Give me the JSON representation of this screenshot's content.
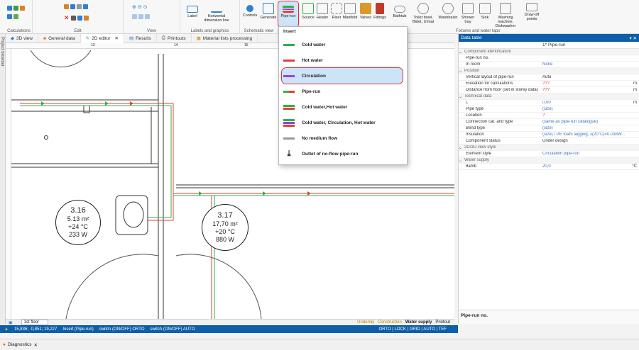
{
  "ribbon": {
    "groups": [
      "Calculations",
      "Edit",
      "View",
      "Labels and graphics",
      "Schematic view",
      "Fixtures and water taps"
    ],
    "buttons": {
      "label": "Label",
      "horizontal_dimension_line": "Horizontal dimension line",
      "controls": "Controls",
      "generate": "Generate",
      "pipe_run": "Pipe-run",
      "source": "Source",
      "heater": "Heater",
      "riser": "Riser",
      "manifold": "Manifold",
      "valves": "Valves",
      "fittings": "Fittings",
      "bathtub": "Bathtub",
      "toilet_bowl": "Toilet bowl, Bidet, Urinal",
      "washbasin": "Washbasin",
      "shower_tray": "Shower tray",
      "sink": "Sink",
      "washing_machine": "Washing machine, Dishwasher",
      "draw_off_points": "Draw-off points"
    }
  },
  "tabs": [
    "3D view",
    "General data",
    "2D editor",
    "Results",
    "Printouts",
    "Material lists processing"
  ],
  "left_strip": "Project browser",
  "ruler": {
    "marks": [
      "13",
      "14",
      "15"
    ]
  },
  "dropdown": {
    "header": "Insert",
    "items": [
      {
        "label": "Cold water",
        "colors": [
          "#2fb24a"
        ]
      },
      {
        "label": "Hot water",
        "colors": [
          "#e2412f"
        ]
      },
      {
        "label": "Circulation",
        "colors": [
          "#a13fd6"
        ]
      },
      {
        "label": "Pipe-run",
        "colors": [
          "#2fb24a",
          "#e2412f"
        ]
      },
      {
        "label": "Cold water,Hot water",
        "colors": [
          "#2fb24a",
          "#e2412f"
        ]
      },
      {
        "label": "Cold water, Circulation, Hot water",
        "colors": [
          "#2fb24a",
          "#a13fd6",
          "#e2412f"
        ]
      },
      {
        "label": "No medium flow",
        "colors": [
          "#9a9a9a"
        ]
      },
      {
        "label": "Outlet of no-flow pipe-run",
        "icon": "download-icon"
      }
    ]
  },
  "rooms": [
    {
      "number": "3.16",
      "area": "5.13 m²",
      "temp": "+24 °C",
      "power": "233 W"
    },
    {
      "number": "3.17",
      "area": "17,70 m²",
      "temp": "+20 °C",
      "power": "880 W"
    }
  ],
  "data_table": {
    "title": "Data table",
    "subtitle": "1* Pipe-run",
    "rows": [
      {
        "section": "Component identification"
      },
      {
        "k": "Pipe-run no.",
        "v": "",
        "u": ""
      },
      {
        "k": "In room",
        "v": "None",
        "u": ""
      },
      {
        "section": "Position"
      },
      {
        "k": "Vertical layout of pipe-run",
        "v": "Auto",
        "u": ""
      },
      {
        "k": "Elevation for calculations",
        "v": "???",
        "u": "m"
      },
      {
        "k": "Distance from floor (set in storey data)",
        "v": "???",
        "u": "m"
      },
      {
        "section": "Technical data"
      },
      {
        "k": "L",
        "v": "0,00",
        "u": "m"
      },
      {
        "k": "Pipe type",
        "v": "(size)",
        "u": ""
      },
      {
        "k": "Location",
        "v": "?",
        "u": ""
      },
      {
        "k": "Connection cat. and type",
        "v": "(same as pipe-run catalogue)",
        "u": ""
      },
      {
        "k": "Bend type",
        "v": "(size)",
        "u": ""
      },
      {
        "k": "Insulation",
        "v": "(size) / PE foam lagging, λ(20°C)=0,038W...",
        "u": ""
      },
      {
        "k": "Component status",
        "v": "Under design",
        "u": ""
      },
      {
        "section": "2D/3D view style"
      },
      {
        "k": "Element style",
        "v": "Circulation pipe-run",
        "u": ""
      },
      {
        "section": "Water supply"
      },
      {
        "k": "θamb",
        "v": "20,0",
        "u": "°C"
      }
    ],
    "description": "Pipe-run no."
  },
  "floor_bar": {
    "floor": "1st floor",
    "toggles": [
      "Underlay",
      "Construction",
      "Water supply",
      "Printout"
    ]
  },
  "status_bar": {
    "coords": "15,836; -0,851; 19,227",
    "mode": "Insert (Pipe-run)",
    "ortho": "switch (ON/OFF) ORTO",
    "auto": "switch (ON/OFF) AUTO",
    "flags": "ORTO | LOCK | GRID | AUTO | TEF"
  },
  "diagnostics": "Diagnostics"
}
